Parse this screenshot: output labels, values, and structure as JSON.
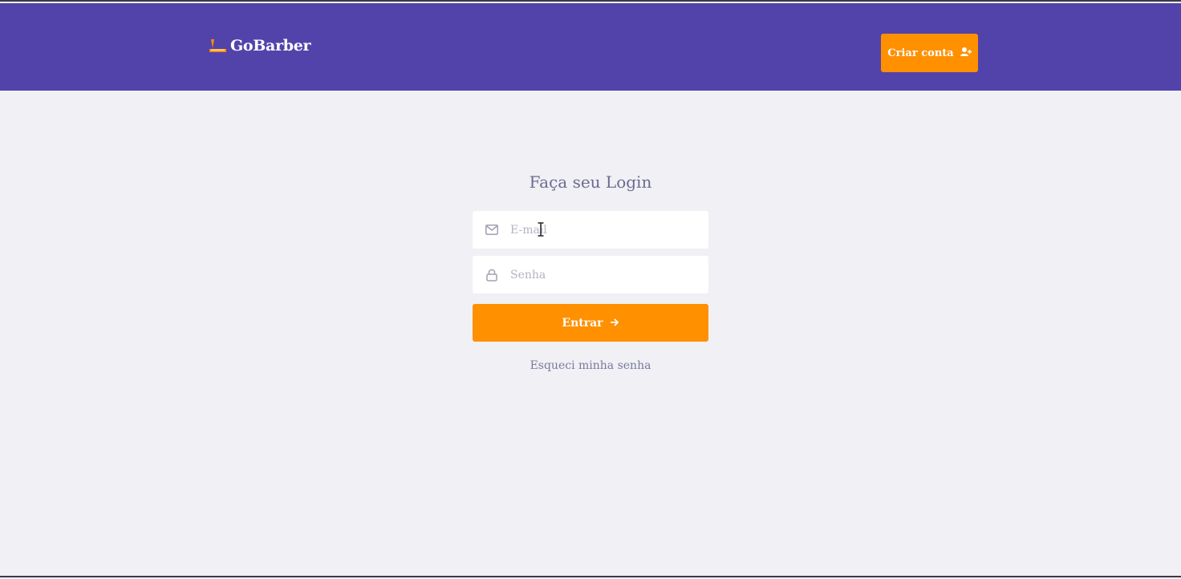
{
  "header": {
    "logo_text": "GoBarber",
    "signup_label": "Criar conta"
  },
  "login": {
    "title": "Faça seu Login",
    "email_placeholder": "E-mail",
    "password_placeholder": "Senha",
    "submit_label": "Entrar",
    "forgot_label": "Esqueci minha senha"
  },
  "colors": {
    "header_bg": "#5243aa",
    "accent": "#ff9000",
    "page_bg": "#f0f0f5"
  },
  "icons": {
    "logo": "scissors-razor-icon",
    "signup": "user-plus-icon",
    "email": "mail-icon",
    "password": "lock-icon",
    "submit": "arrow-right-icon"
  }
}
